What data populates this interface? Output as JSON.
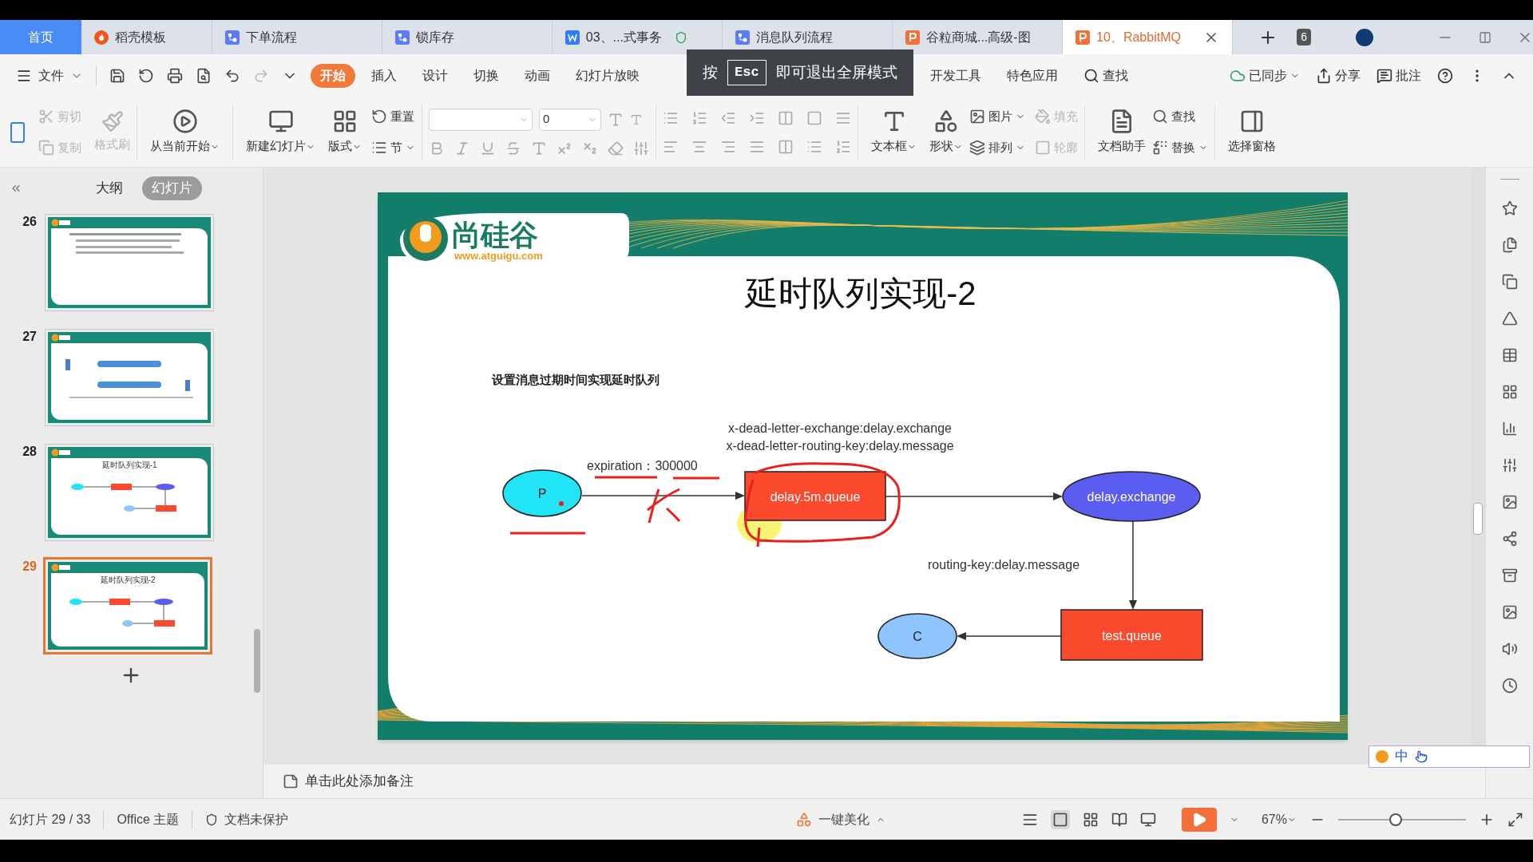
{
  "window_tabs": [
    {
      "label": "首页",
      "kind": "home",
      "selected": false
    },
    {
      "label": "稻壳模板",
      "kind": "docer",
      "selected": false
    },
    {
      "label": "下单流程",
      "kind": "flow",
      "selected": false
    },
    {
      "label": "锁库存",
      "kind": "flow",
      "selected": false
    },
    {
      "label": "03、...式事务",
      "kind": "word",
      "selected": false
    },
    {
      "label": "消息队列流程",
      "kind": "flow",
      "selected": false
    },
    {
      "label": "谷粒商城...高级-图",
      "kind": "ppt",
      "selected": false
    },
    {
      "label": "10、RabbitMQ",
      "kind": "ppt",
      "selected": true
    }
  ],
  "window_count": "6",
  "menu": {
    "file": "文件",
    "ribbon_tabs": [
      {
        "label": "开始",
        "selected": true
      },
      {
        "label": "插入",
        "selected": false
      },
      {
        "label": "设计",
        "selected": false
      },
      {
        "label": "切换",
        "selected": false
      },
      {
        "label": "动画",
        "selected": false
      },
      {
        "label": "幻灯片放映",
        "selected": false
      }
    ],
    "more_tabs": [
      "开发工具",
      "特色应用"
    ],
    "search": "查找",
    "sync": "已同步",
    "share": "分享",
    "comment": "批注"
  },
  "fullscreen_hint": {
    "prefix": "按",
    "key": "Esc",
    "suffix": "即可退出全屏模式"
  },
  "ribbon": {
    "cut": {
      "label": "剪切",
      "disabled": true
    },
    "copy": {
      "label": "复制",
      "disabled": true
    },
    "format_painter": {
      "label": "格式刷",
      "disabled": true
    },
    "play_from_current": "从当前开始",
    "new_slide": "新建幻灯片",
    "layout": "版式",
    "reset": "重置",
    "section": "节",
    "font_size": "0",
    "text_box": "文本框",
    "shape": "形状",
    "picture": "图片",
    "arrange": "排列",
    "fill": {
      "label": "填充",
      "disabled": true
    },
    "outline": {
      "label": "轮廓",
      "disabled": true
    },
    "doc_assistant": "文档助手",
    "find": "查找",
    "replace": "替换",
    "selection_pane": "选择窗格"
  },
  "panel": {
    "tabs": [
      {
        "label": "大纲",
        "selected": false
      },
      {
        "label": "幻灯片",
        "selected": true
      }
    ],
    "slides": [
      {
        "number": "26",
        "kind": "bullets",
        "selected": false
      },
      {
        "number": "27",
        "kind": "flow",
        "selected": false
      },
      {
        "number": "28",
        "kind": "diagram",
        "title": "延时队列实现-1",
        "selected": false
      },
      {
        "number": "29",
        "kind": "diagram",
        "title": "延时队列实现-2",
        "selected": true
      }
    ]
  },
  "slide": {
    "logo": {
      "brand": "尚硅谷",
      "url": "www.atguigu.com"
    },
    "title": "延时队列实现-2",
    "subtitle": "设置消息过期时间实现延时队列",
    "notes": [
      "x-dead-letter-exchange:delay.exchange",
      "x-dead-letter-routing-key:delay.message"
    ],
    "nodes": [
      {
        "kind": "ellipse",
        "label": "P",
        "color": "#22e4f7"
      },
      {
        "kind": "rect",
        "label": "delay.5m.queue",
        "color": "#fb4a2e"
      },
      {
        "kind": "ellipse",
        "label": "delay.exchange",
        "color": "#5b5cf0"
      },
      {
        "kind": "ellipse",
        "label": "C",
        "color": "#8ec5ff"
      },
      {
        "kind": "rect",
        "label": "test.queue",
        "color": "#fb4a2e"
      }
    ],
    "edge_labels": [
      "expiration：300000",
      "routing-key:delay.message"
    ]
  },
  "notes_placeholder": "单击此处添加备注",
  "ime": "中",
  "status_bar": {
    "slide_info": "幻灯片 29 / 33",
    "theme": "Office 主题",
    "protection": "文档未保护",
    "beautify": "一键美化",
    "zoom": "67%",
    "zoom_slider": {
      "level": 0.45
    }
  }
}
